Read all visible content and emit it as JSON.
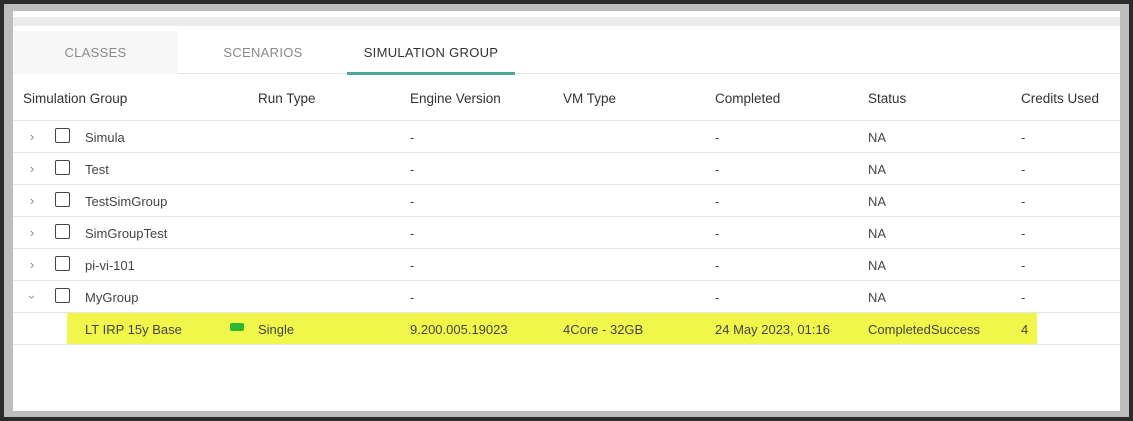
{
  "tabs": [
    {
      "label": "CLASSES"
    },
    {
      "label": "SCENARIOS"
    },
    {
      "label": "SIMULATION GROUP"
    }
  ],
  "table": {
    "headers": [
      "Simulation Group",
      "Run Type",
      "Engine Version",
      "VM Type",
      "Completed",
      "Status",
      "Credits Used"
    ],
    "groups": [
      {
        "name": "Simula",
        "engine": "-",
        "completed": "-",
        "status": "NA",
        "credits": "-"
      },
      {
        "name": "Test",
        "engine": "-",
        "completed": "-",
        "status": "NA",
        "credits": "-"
      },
      {
        "name": "TestSimGroup",
        "engine": "-",
        "completed": "-",
        "status": "NA",
        "credits": "-"
      },
      {
        "name": "SimGroupTest",
        "engine": "-",
        "completed": "-",
        "status": "NA",
        "credits": "-"
      },
      {
        "name": "pi-vi-101",
        "engine": "-",
        "completed": "-",
        "status": "NA",
        "credits": "-"
      },
      {
        "name": "MyGroup",
        "engine": "-",
        "completed": "-",
        "status": "NA",
        "credits": "-"
      }
    ],
    "child": {
      "name": "LT IRP 15y Base",
      "run_type": "Single",
      "engine": "9.200.005.19023",
      "vm_type": "4Core - 32GB",
      "completed": "24 May 2023, 01:16",
      "status": "CompletedSuccess",
      "credits": "4"
    }
  },
  "icons": {
    "collapsed": "chevron-right-icon",
    "expanded": "chevron-down-icon",
    "status_pill": "status-indicator-icon"
  },
  "colors": {
    "tab_active": "#4aa89c",
    "highlight": "#f1f74a",
    "status_green": "#2fb82f"
  }
}
